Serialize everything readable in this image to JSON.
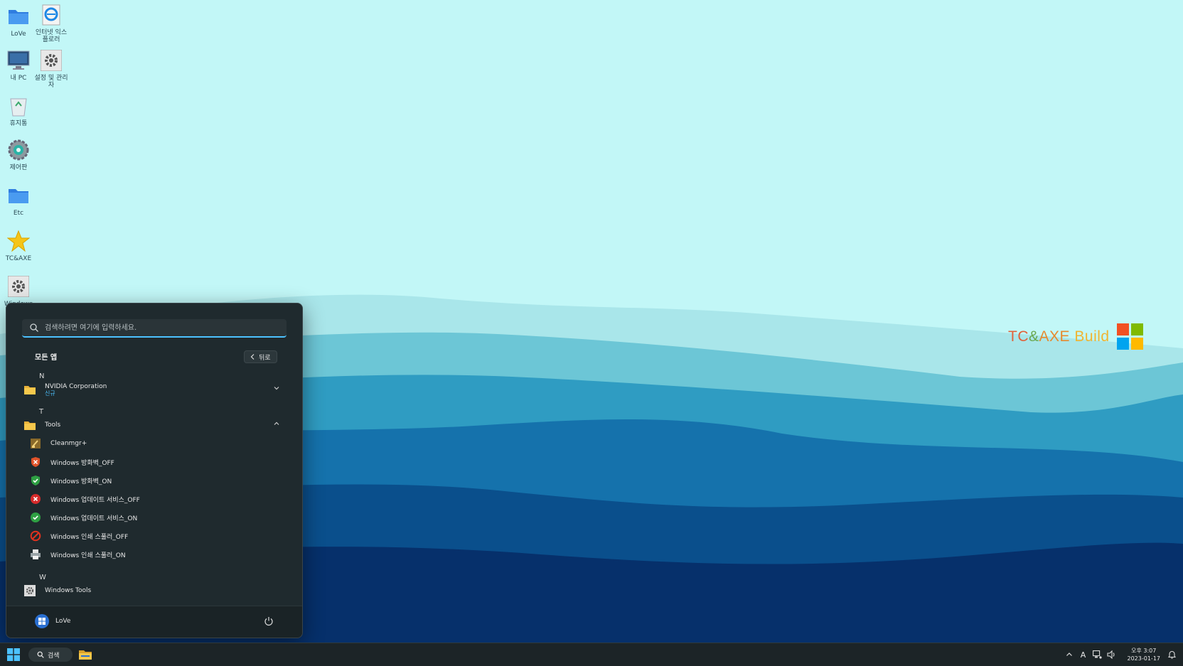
{
  "desktop": {
    "icons": [
      {
        "label": "LoVe",
        "icon": "folder-icon"
      },
      {
        "label": "인터넷 익스플로러",
        "icon": "ie-icon"
      },
      {
        "label": "내 PC",
        "icon": "monitor-icon"
      },
      {
        "label": "설정 및 관리자",
        "icon": "gear-icon"
      },
      {
        "label": "휴지통",
        "icon": "recycle-bin-icon"
      },
      {
        "label": "제어판",
        "icon": "control-panel-icon"
      },
      {
        "label": "Etc",
        "icon": "folder-icon"
      },
      {
        "label": "TC&AXE",
        "icon": "star-icon"
      },
      {
        "label": "Windows",
        "icon": "gear-icon"
      }
    ]
  },
  "brand": {
    "tc": "TC",
    "amp": "&",
    "axe": "AXE",
    "build": " Build"
  },
  "start_menu": {
    "search_placeholder": "검색하려면 여기에 입력하세요.",
    "title": "모든 앱",
    "back_label": "뒤로",
    "sections": [
      {
        "letter": "N"
      },
      {
        "letter": "T"
      },
      {
        "letter": "W"
      }
    ],
    "apps": {
      "nvidia": {
        "name": "NVIDIA Corporation",
        "badge": "신규"
      },
      "tools": {
        "name": "Tools"
      },
      "cleanmgr": {
        "name": "Cleanmgr+"
      },
      "fw_off": {
        "name": "Windows 방화벽_OFF"
      },
      "fw_on": {
        "name": "Windows 방화벽_ON"
      },
      "wu_off": {
        "name": "Windows 업데이트 서비스_OFF"
      },
      "wu_on": {
        "name": "Windows 업데이트 서비스_ON"
      },
      "sp_off": {
        "name": "Windows 인쇄 스풀러_OFF"
      },
      "sp_on": {
        "name": "Windows 인쇄 스풀러_ON"
      },
      "wintools": {
        "name": "Windows Tools"
      }
    },
    "user_name": "LoVe"
  },
  "taskbar": {
    "search_label": "검색",
    "ime_indicator": "A",
    "time": "오후 3:07",
    "date": "2023-01-17"
  },
  "colors": {
    "accent": "#4cc2ff",
    "menu_bg": "#1f2a2e",
    "taskbar_bg": "#1c2427",
    "logo_red": "#f25022",
    "logo_green": "#7fba00",
    "logo_blue": "#00a4ef",
    "logo_yellow": "#ffb900"
  }
}
